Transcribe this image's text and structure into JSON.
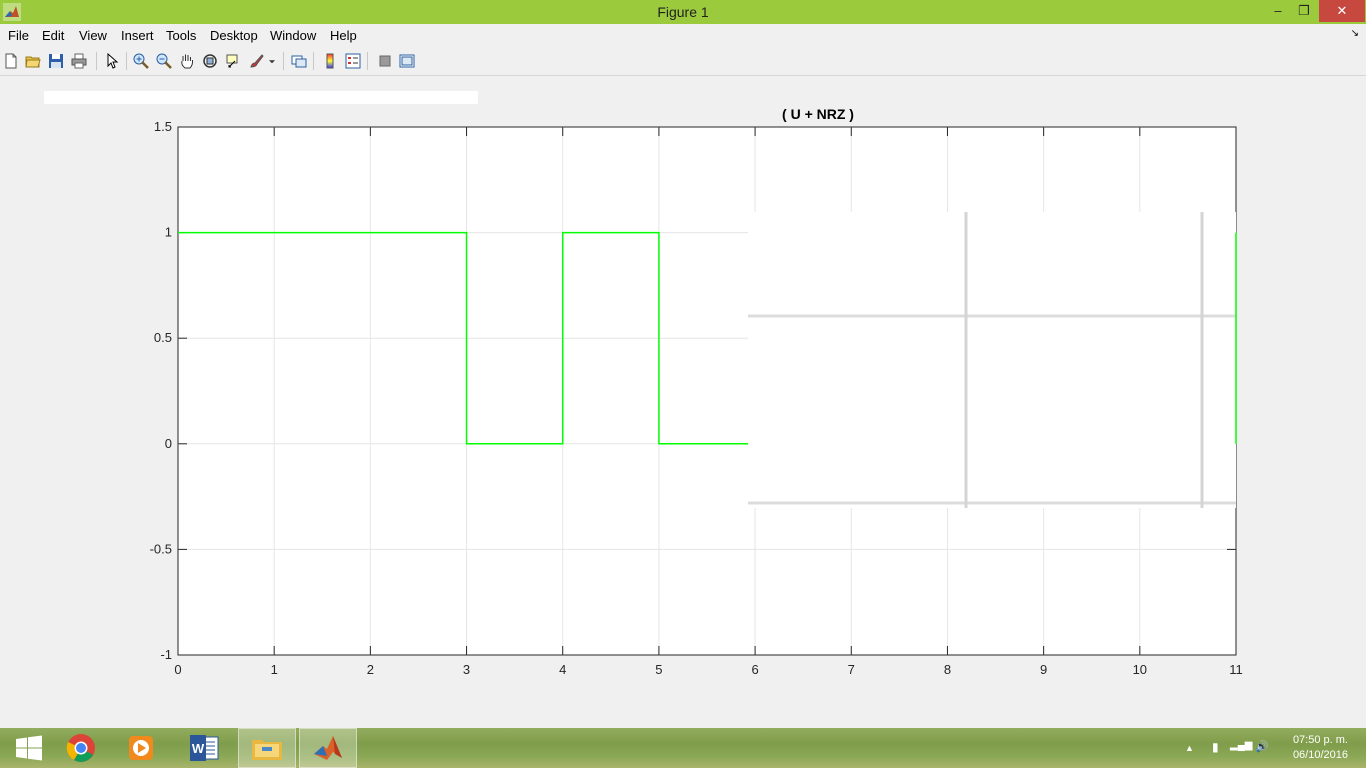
{
  "window": {
    "title": "Figure 1",
    "minimize_glyph": "–",
    "restore_glyph": "❐",
    "close_glyph": "✕"
  },
  "menu": [
    "File",
    "Edit",
    "View",
    "Insert",
    "Tools",
    "Desktop",
    "Window",
    "Help"
  ],
  "menu_dock_glyph": "↘",
  "toolbar_icons": [
    "new-figure-icon",
    "open-file-icon",
    "save-icon",
    "print-icon",
    "edit-plot-arrow-icon",
    "zoom-in-icon",
    "zoom-out-icon",
    "pan-hand-icon",
    "rotate-3d-icon",
    "data-cursor-icon",
    "brush-icon",
    "link-plot-icon",
    "colorbar-icon",
    "legend-icon",
    "hide-plot-tools-icon",
    "show-plot-tools-icon"
  ],
  "chart_data": {
    "type": "line",
    "title": "( U + NRZ )",
    "xlabel": "",
    "ylabel": "",
    "xlim": [
      0,
      11
    ],
    "ylim": [
      -1,
      1.5
    ],
    "x_ticks": [
      "0",
      "1",
      "2",
      "3",
      "4",
      "5",
      "6",
      "7",
      "8",
      "9",
      "10",
      "11"
    ],
    "y_ticks": [
      "-1",
      "-0.5",
      "0",
      "0.5",
      "1",
      "1.5"
    ],
    "grid": true,
    "line_color": "#00ff00",
    "series": [
      {
        "x": [
          0,
          3,
          3,
          4,
          4,
          5,
          5,
          6,
          11,
          11
        ],
        "y": [
          1,
          1,
          0,
          0,
          1,
          1,
          0,
          0,
          1,
          0
        ]
      }
    ]
  },
  "taskbar": {
    "apps": [
      "windows-start-icon",
      "chrome-icon",
      "media-player-icon",
      "word-icon",
      "file-explorer-icon",
      "matlab-icon"
    ],
    "clock_time": "07:50 p. m.",
    "clock_date": "06/10/2016",
    "tray_glyphs": [
      "▲",
      "▮",
      "▂▄▆",
      "🔊"
    ]
  }
}
